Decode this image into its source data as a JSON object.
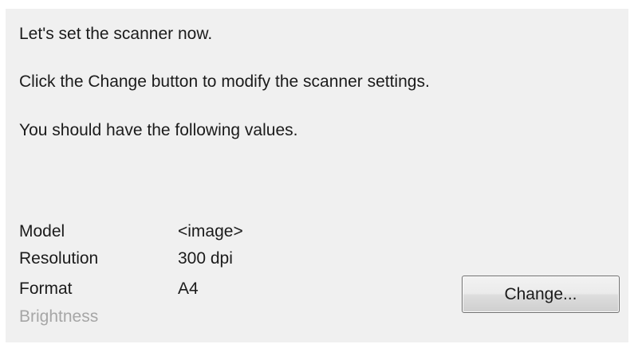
{
  "instructions": {
    "line1": "Let's set the scanner now.",
    "line2": "Click the Change button to modify the scanner settings.",
    "line3": "You should have the following values."
  },
  "settings": [
    {
      "label": "Model",
      "value": "<image>",
      "enabled": true
    },
    {
      "label": "Resolution",
      "value": "300 dpi",
      "enabled": true
    },
    {
      "label": "Format",
      "value": "A4",
      "enabled": true
    },
    {
      "label": "Brightness",
      "value": "",
      "enabled": false
    }
  ],
  "change_button": {
    "label": "Change..."
  },
  "colors": {
    "panel_background": "#f0f0f0",
    "text": "#1b1b1b",
    "disabled_text": "#a6a6a6"
  }
}
